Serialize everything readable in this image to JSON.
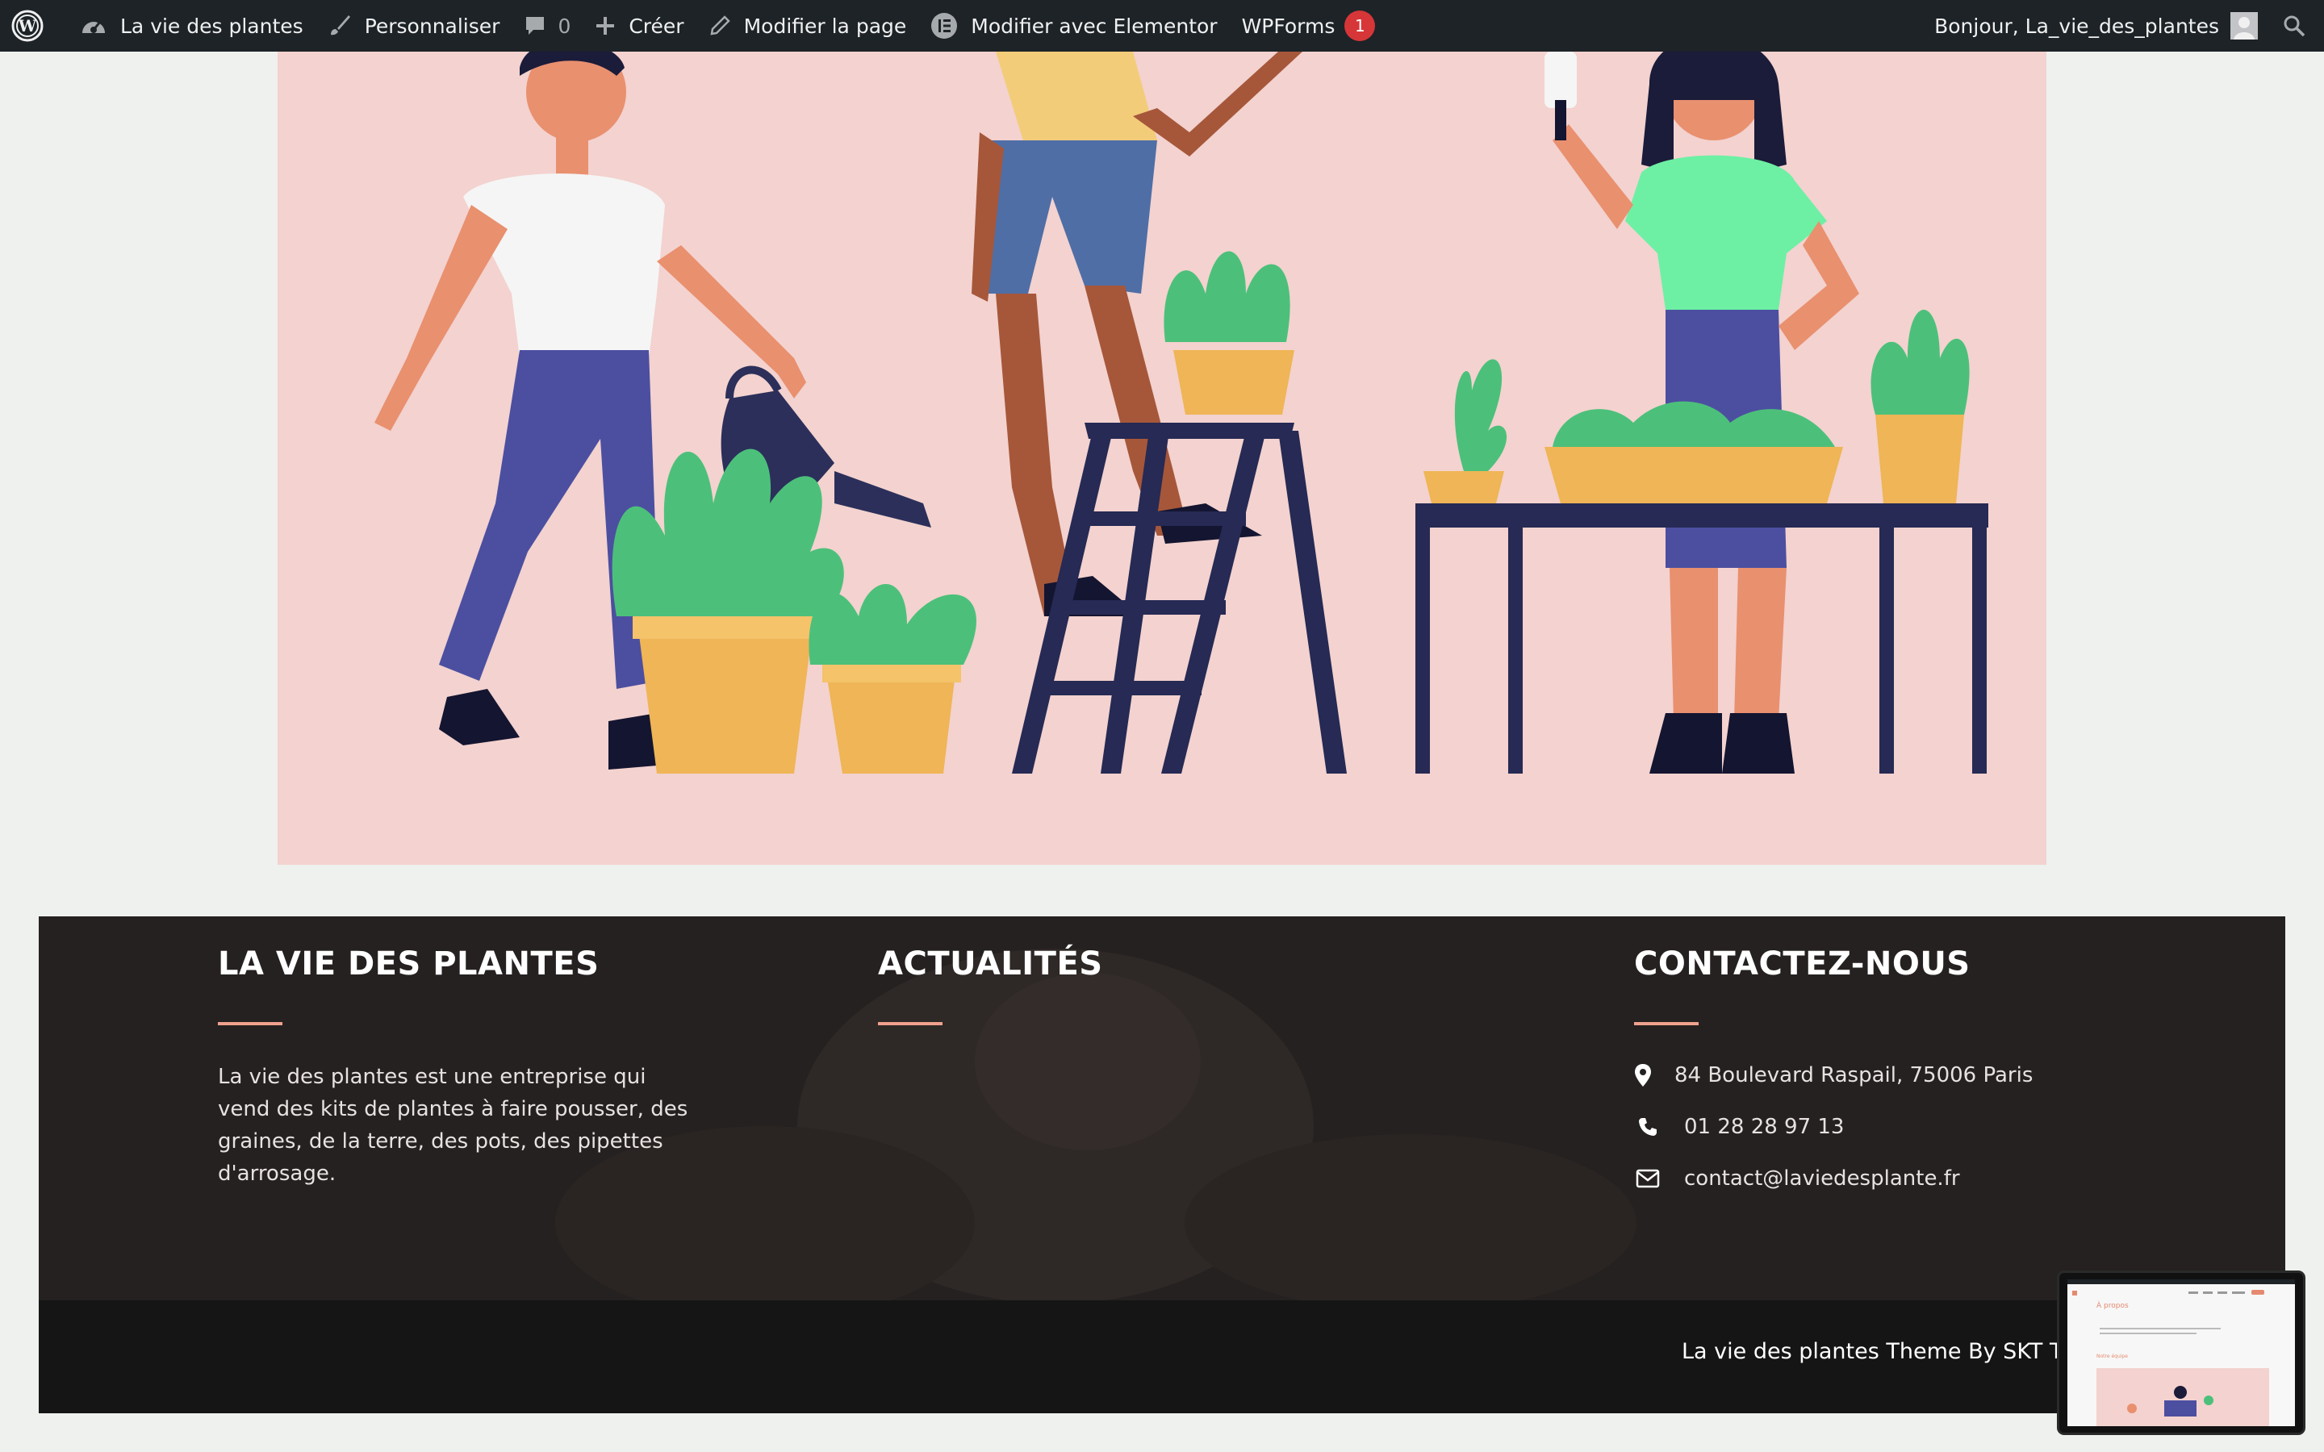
{
  "admin_bar": {
    "site_name": "La vie des plantes",
    "customize": "Personnaliser",
    "comments_count": "0",
    "new": "Créer",
    "edit_page": "Modifier la page",
    "edit_elementor": "Modifier avec Elementor",
    "wpforms": "WPForms",
    "wpforms_badge": "1",
    "greeting": "Bonjour, La_vie_des_plantes"
  },
  "footer": {
    "about": {
      "heading": "LA VIE DES PLANTES",
      "text": "La vie des plantes est une entreprise qui vend des kits de plantes à faire pousser, des graines, de la terre, des pots, des pipettes d'arrosage."
    },
    "news": {
      "heading": "ACTUALITÉS"
    },
    "contact": {
      "heading": "CONTACTEZ-NOUS",
      "address": "84 Boulevard Raspail, 75006 Paris",
      "phone": "01 28 28 97 13",
      "email": "contact@laviedesplante.fr"
    },
    "credit": "La vie des plantes Theme By SKT Themes"
  },
  "thumbnail": {
    "title": "À propos",
    "subtitle": "Notre équipe"
  },
  "colors": {
    "admin_bar_bg": "#1d2327",
    "hero_bg": "#f3d2cf",
    "footer_bg": "#252120",
    "footer_bottom_bg": "#151515",
    "accent": "#f0a18e"
  }
}
